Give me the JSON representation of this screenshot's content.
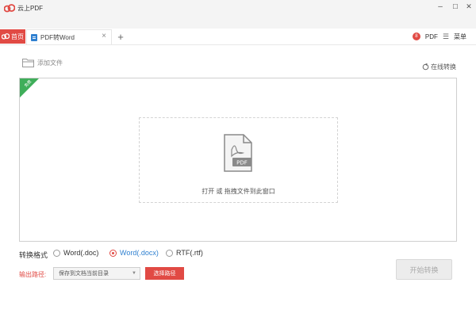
{
  "titlebar": {
    "app_name": "云上PDF"
  },
  "window_controls": {
    "minimize": "–",
    "maximize": "☐",
    "close": "✕"
  },
  "tabs": {
    "home_label": "首页",
    "active_label": "PDF转Word",
    "close_glyph": "×",
    "add_glyph": "+"
  },
  "toolbar": {
    "avatar_letter": "8",
    "pdf_label": "PDF",
    "menu_glyph": "☰",
    "menu_label": "菜单"
  },
  "actions": {
    "add_file_label": "添加文件",
    "online_convert_label": "在线转换"
  },
  "drop_zone": {
    "corner_badge": "免费",
    "file_badge": "PDF",
    "hint": "打开 或 拖拽文件到此窗口"
  },
  "format": {
    "label": "转换格式",
    "options": [
      "Word(.doc)",
      "Word(.docx)",
      "RTF(.rtf)"
    ],
    "selected": "Word(.docx)"
  },
  "output": {
    "label": "输出路径:",
    "path_value": "保存到文档当前目录",
    "choose_button": "选择路径"
  },
  "start_button": "开始转换",
  "colors": {
    "accent": "#e14a44",
    "link_blue": "#2f80d0",
    "badge_green": "#3fae5a"
  }
}
